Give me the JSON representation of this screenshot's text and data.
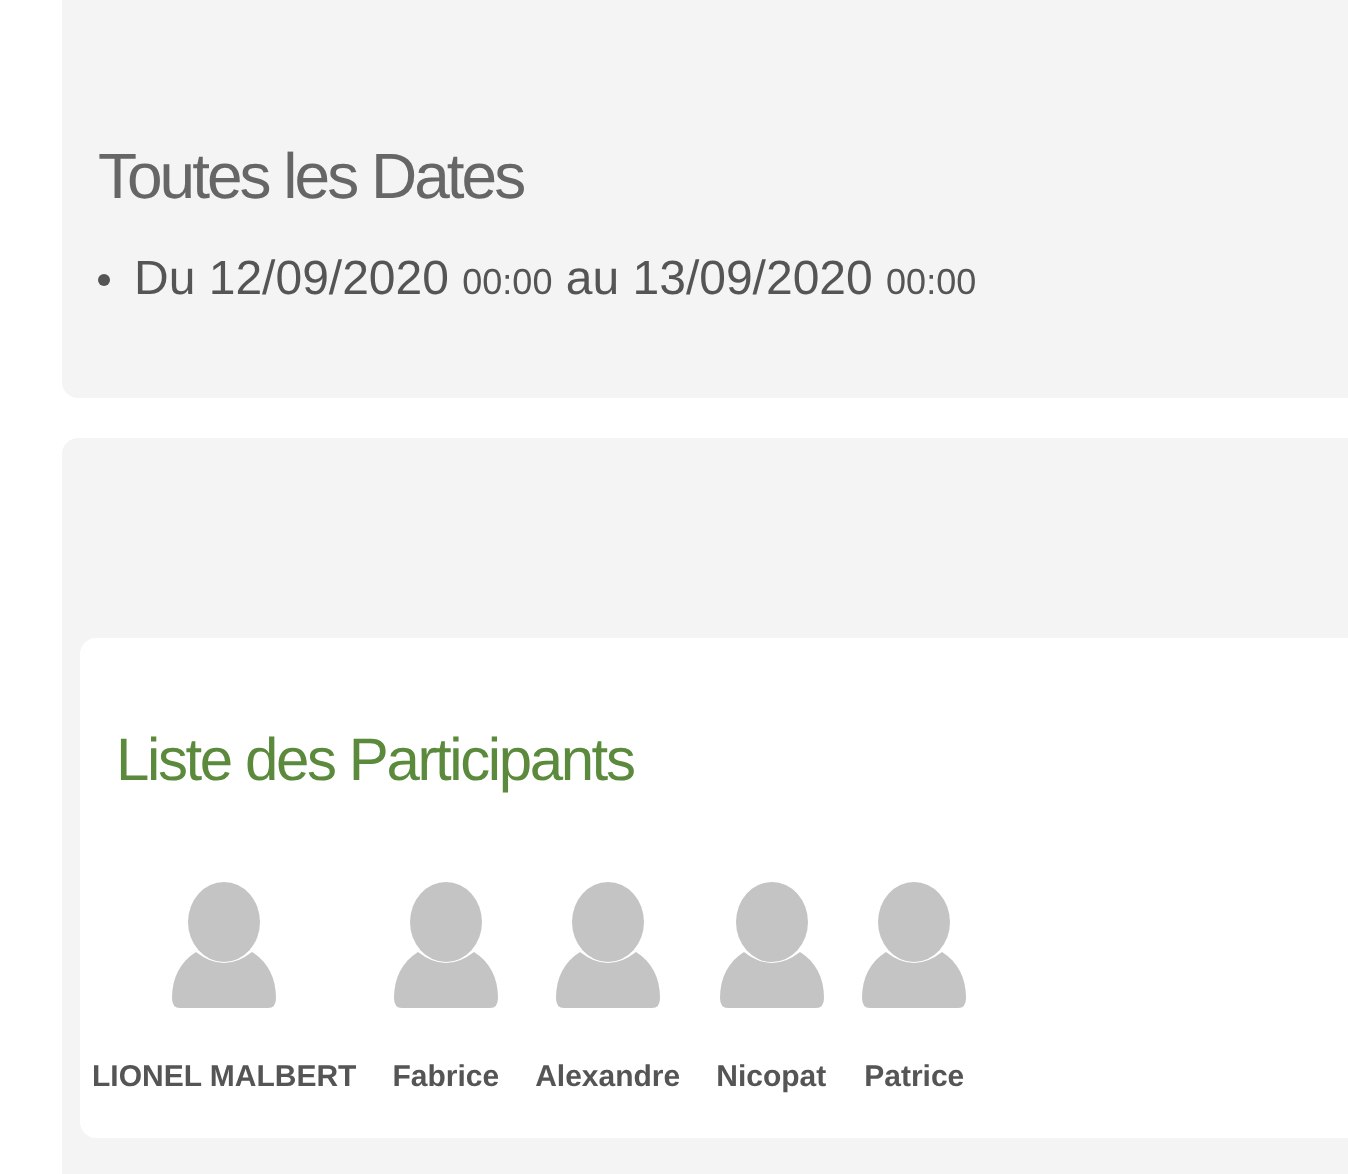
{
  "dates_section": {
    "title": "Toutes les Dates",
    "items": [
      {
        "prefix": "Du",
        "start_date": "12/09/2020",
        "start_time": "00:00",
        "joiner": "au",
        "end_date": "13/09/2020",
        "end_time": "00:00"
      }
    ]
  },
  "participants_section": {
    "title": "Liste des Participants",
    "participants": [
      {
        "name": "LIONEL MALBERT"
      },
      {
        "name": "Fabrice"
      },
      {
        "name": "Alexandre"
      },
      {
        "name": "Nicopat"
      },
      {
        "name": "Patrice"
      }
    ]
  }
}
